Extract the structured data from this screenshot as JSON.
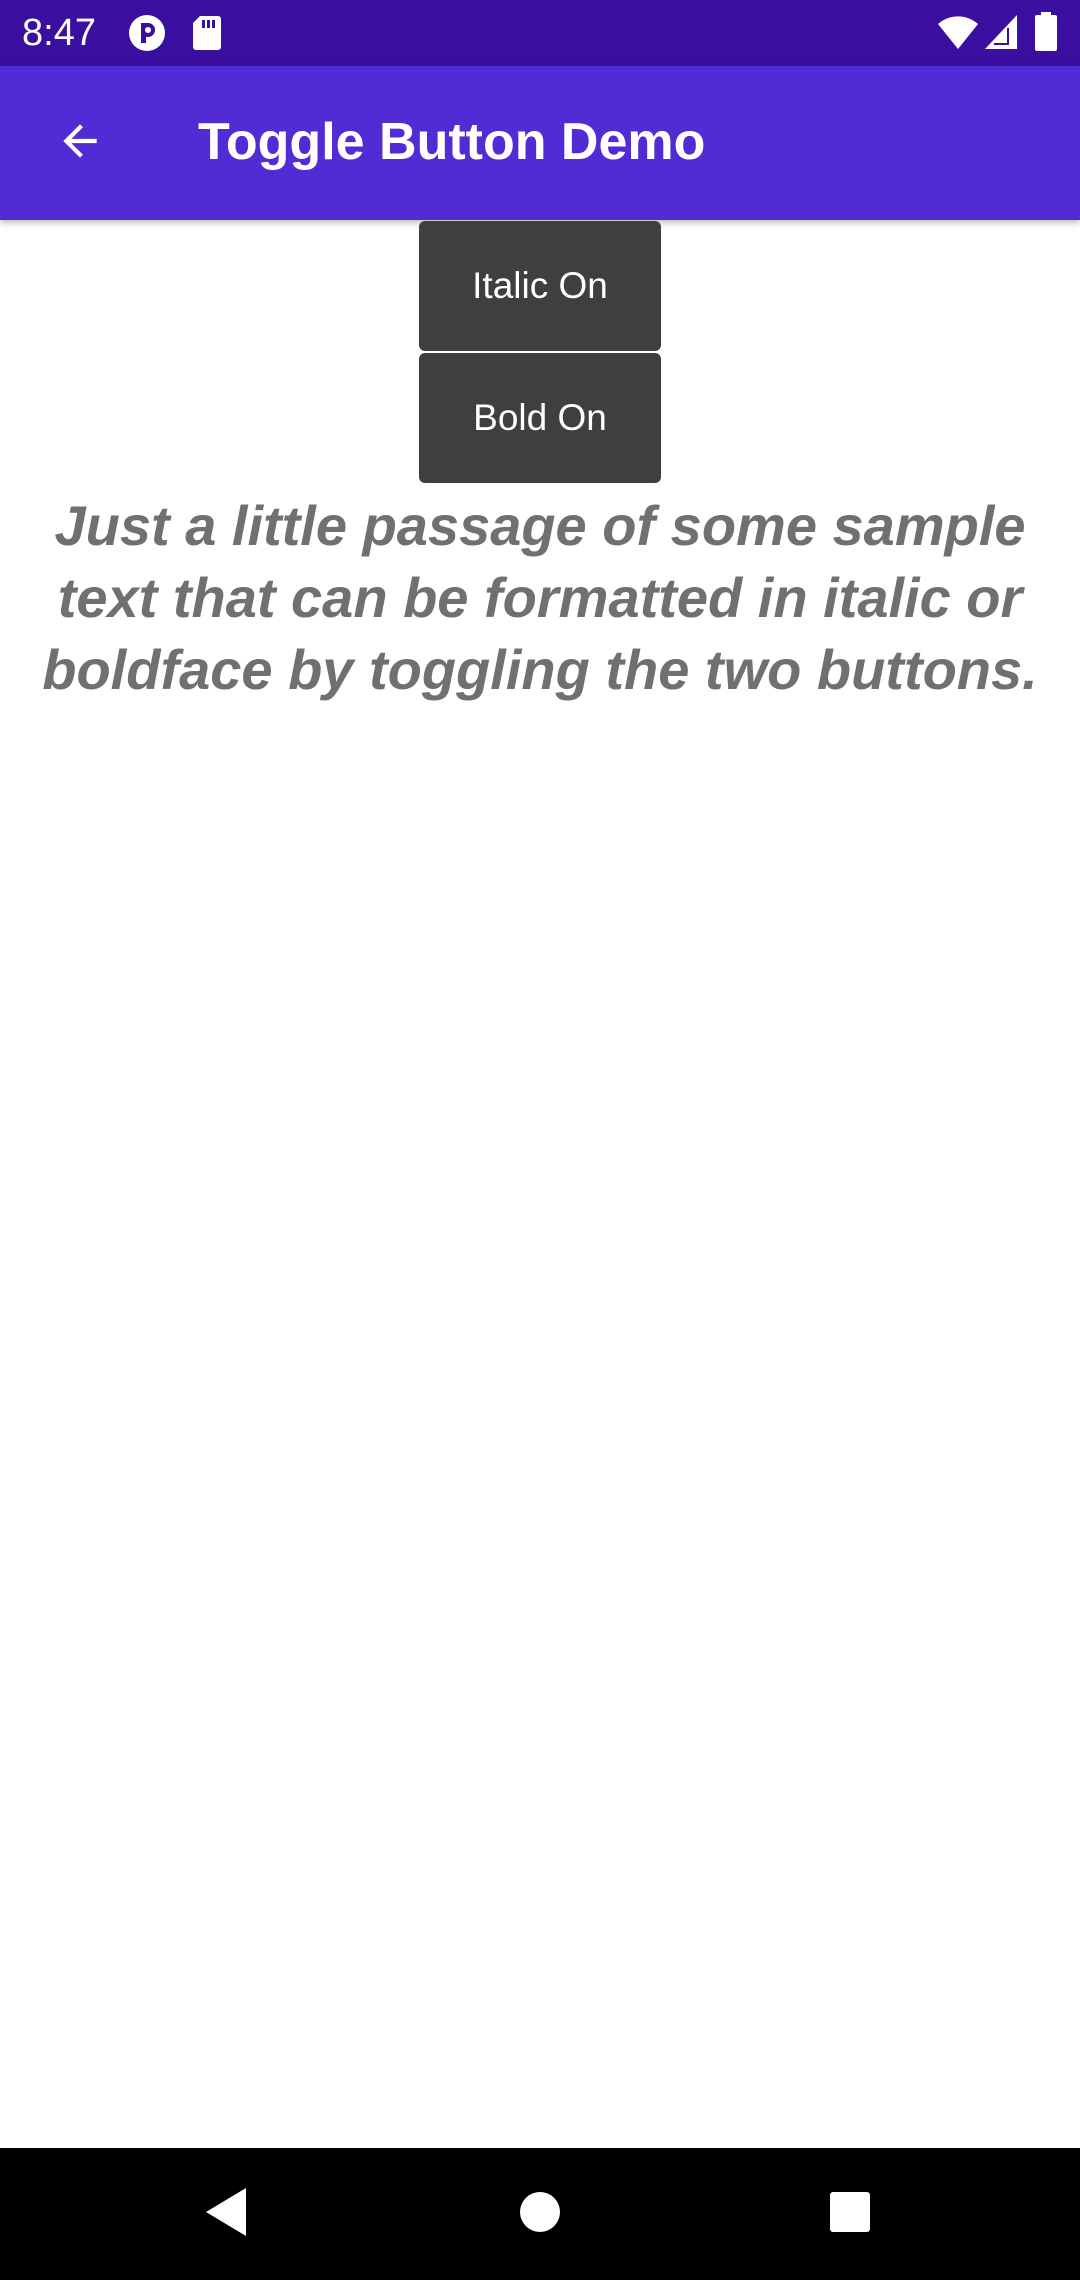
{
  "status_bar": {
    "time": "8:47",
    "icons": [
      "notification-app-icon",
      "sd-card-icon",
      "wifi-icon",
      "signal-icon",
      "battery-icon"
    ]
  },
  "app_bar": {
    "title": "Toggle Button Demo",
    "back_icon": "arrow-left-icon"
  },
  "toggles": {
    "italic_label": "Italic On",
    "bold_label": "Bold On"
  },
  "passage": {
    "text": "Just a little passage of some sample text that can be formatted in italic or boldface by toggling the two buttons."
  },
  "nav_bar": {
    "icons": [
      "nav-back-icon",
      "nav-home-icon",
      "nav-recents-icon"
    ]
  },
  "colors": {
    "status_bar": "#3a0fa0",
    "app_bar": "#512bd4",
    "button": "#3f3f3f",
    "passage_text": "#707070"
  }
}
